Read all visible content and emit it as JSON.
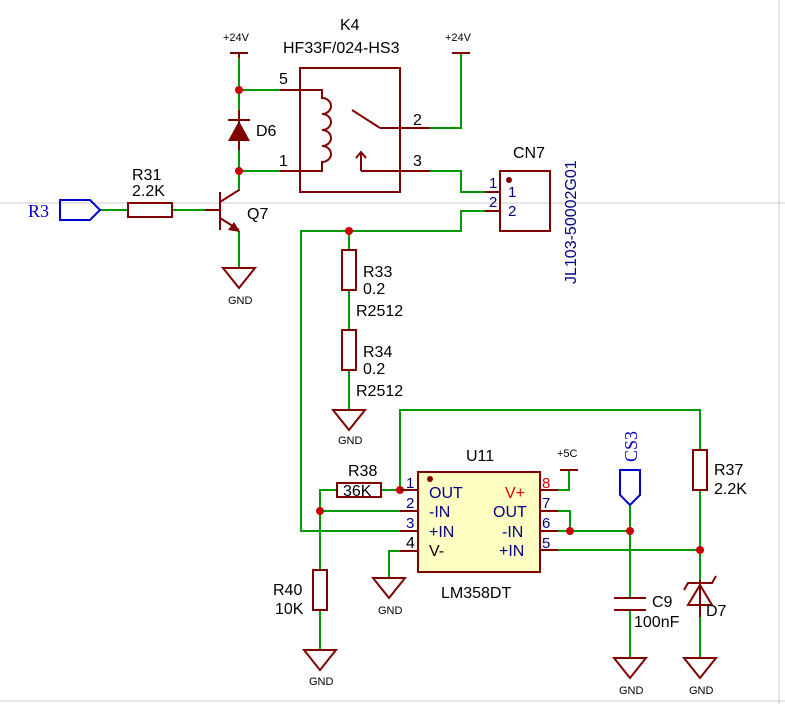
{
  "power": {
    "p24v": "+24V",
    "p5v": "+5C",
    "gnd": "GND"
  },
  "netports": {
    "r3": "R3",
    "cs3": "CS3"
  },
  "k4": {
    "ref": "K4",
    "value": "HF33F/024-HS3",
    "pins": [
      "5",
      "1",
      "2",
      "3"
    ]
  },
  "d6": {
    "ref": "D6"
  },
  "r31": {
    "ref": "R31",
    "value": "2.2K"
  },
  "q7": {
    "ref": "Q7"
  },
  "cn7": {
    "ref": "CN7",
    "value": "JL103-50002G01",
    "pins": [
      "1",
      "2"
    ],
    "inner": [
      "1",
      "2"
    ]
  },
  "r33": {
    "ref": "R33",
    "value": "0.2",
    "footprint": "R2512"
  },
  "r34": {
    "ref": "R34",
    "value": "0.2",
    "footprint": "R2512"
  },
  "r38": {
    "ref": "R38",
    "value": "36K"
  },
  "r40": {
    "ref": "R40",
    "value": "10K"
  },
  "r37": {
    "ref": "R37",
    "value": "2.2K"
  },
  "c9": {
    "ref": "C9",
    "value": "100nF"
  },
  "d7": {
    "ref": "D7"
  },
  "u11": {
    "ref": "U11",
    "value": "LM358DT",
    "left_pins": [
      {
        "num": "1",
        "name": "OUT"
      },
      {
        "num": "2",
        "name": "-IN"
      },
      {
        "num": "3",
        "name": "+IN"
      },
      {
        "num": "4",
        "name": "V-"
      }
    ],
    "right_pins": [
      {
        "num": "8",
        "name": "V+"
      },
      {
        "num": "7",
        "name": "OUT"
      },
      {
        "num": "6",
        "name": "-IN"
      },
      {
        "num": "5",
        "name": "+IN"
      }
    ]
  }
}
